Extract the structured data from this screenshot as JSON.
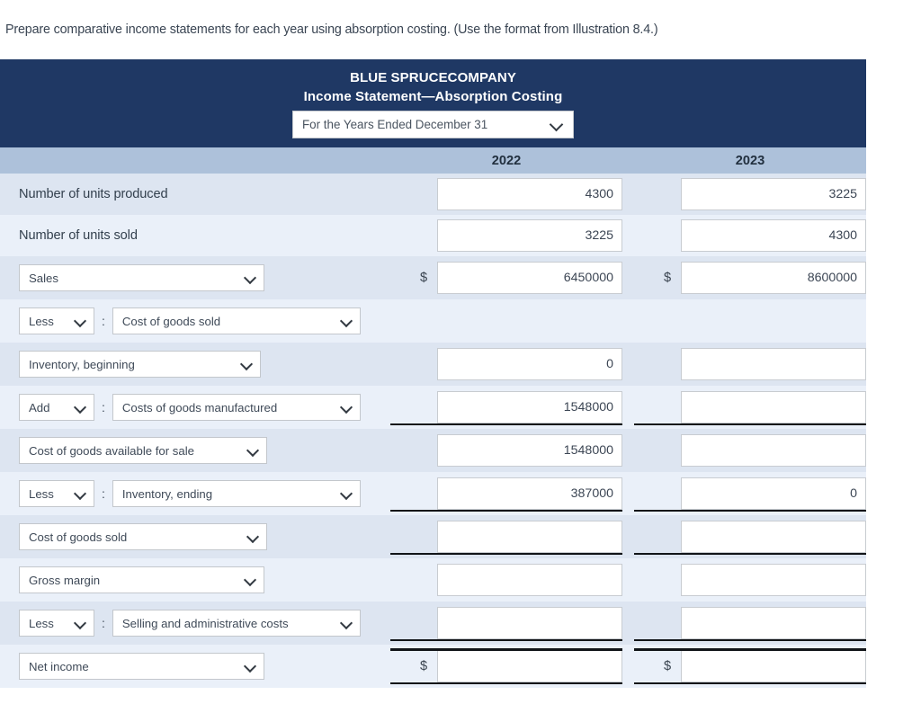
{
  "prompt": "Prepare comparative income statements for each year using absorption costing. (Use the format from Illustration 8.4.)",
  "statement": {
    "company": "BLUE SPRUCECOMPANY",
    "subtitle": "Income Statement—Absorption Costing",
    "period_select": "For the Years Ended December 31",
    "banner_color": "#1f3864",
    "year_header_color": "#adc1da",
    "columns": [
      "2022",
      "2023"
    ]
  },
  "rows": [
    {
      "kind": "plain",
      "label": "Number of units produced",
      "col1": {
        "dollar": false,
        "value": "4300"
      },
      "col2": {
        "dollar": false,
        "value": "3225"
      }
    },
    {
      "kind": "plain",
      "label": "Number of units sold",
      "col1": {
        "dollar": false,
        "value": "3225"
      },
      "col2": {
        "dollar": false,
        "value": "4300"
      }
    },
    {
      "kind": "select",
      "label": "Sales",
      "col1": {
        "dollar": true,
        "value": "6450000"
      },
      "col2": {
        "dollar": true,
        "value": "8600000"
      }
    },
    {
      "kind": "op-select",
      "op": "Less",
      "label": "Cost of goods sold",
      "col1": {
        "dollar": false,
        "value": "",
        "hidden": true
      },
      "col2": {
        "dollar": false,
        "value": "",
        "hidden": true
      }
    },
    {
      "kind": "select",
      "label": "Inventory, beginning",
      "col1": {
        "dollar": false,
        "value": "0"
      },
      "col2": {
        "dollar": false,
        "value": ""
      }
    },
    {
      "kind": "op-select",
      "op": "Add",
      "label": "Costs of goods manufactured",
      "col1": {
        "dollar": false,
        "value": "1548000",
        "underline": true
      },
      "col2": {
        "dollar": false,
        "value": "",
        "underline": true
      }
    },
    {
      "kind": "select",
      "label": "Cost of goods available for sale",
      "col1": {
        "dollar": false,
        "value": "1548000"
      },
      "col2": {
        "dollar": false,
        "value": ""
      }
    },
    {
      "kind": "op-select",
      "op": "Less",
      "label": "Inventory, ending",
      "col1": {
        "dollar": false,
        "value": "387000",
        "underline": true
      },
      "col2": {
        "dollar": false,
        "value": "0",
        "underline": true
      }
    },
    {
      "kind": "select",
      "label": "Cost of goods sold",
      "col1": {
        "dollar": false,
        "value": "",
        "underline": true
      },
      "col2": {
        "dollar": false,
        "value": "",
        "underline": true
      }
    },
    {
      "kind": "select",
      "label": "Gross margin",
      "col1": {
        "dollar": false,
        "value": ""
      },
      "col2": {
        "dollar": false,
        "value": ""
      }
    },
    {
      "kind": "op-select",
      "op": "Less",
      "label": "Selling and administrative costs",
      "col1": {
        "dollar": false,
        "value": "",
        "underline": true
      },
      "col2": {
        "dollar": false,
        "value": "",
        "underline": true
      }
    },
    {
      "kind": "select",
      "label": "Net income",
      "col1": {
        "dollar": true,
        "value": "",
        "underline": true,
        "underline_top": true
      },
      "col2": {
        "dollar": true,
        "value": "",
        "underline": true,
        "underline_top": true
      }
    }
  ],
  "icons": {
    "chevron_down": "chevron-down-icon"
  },
  "separator": ":"
}
